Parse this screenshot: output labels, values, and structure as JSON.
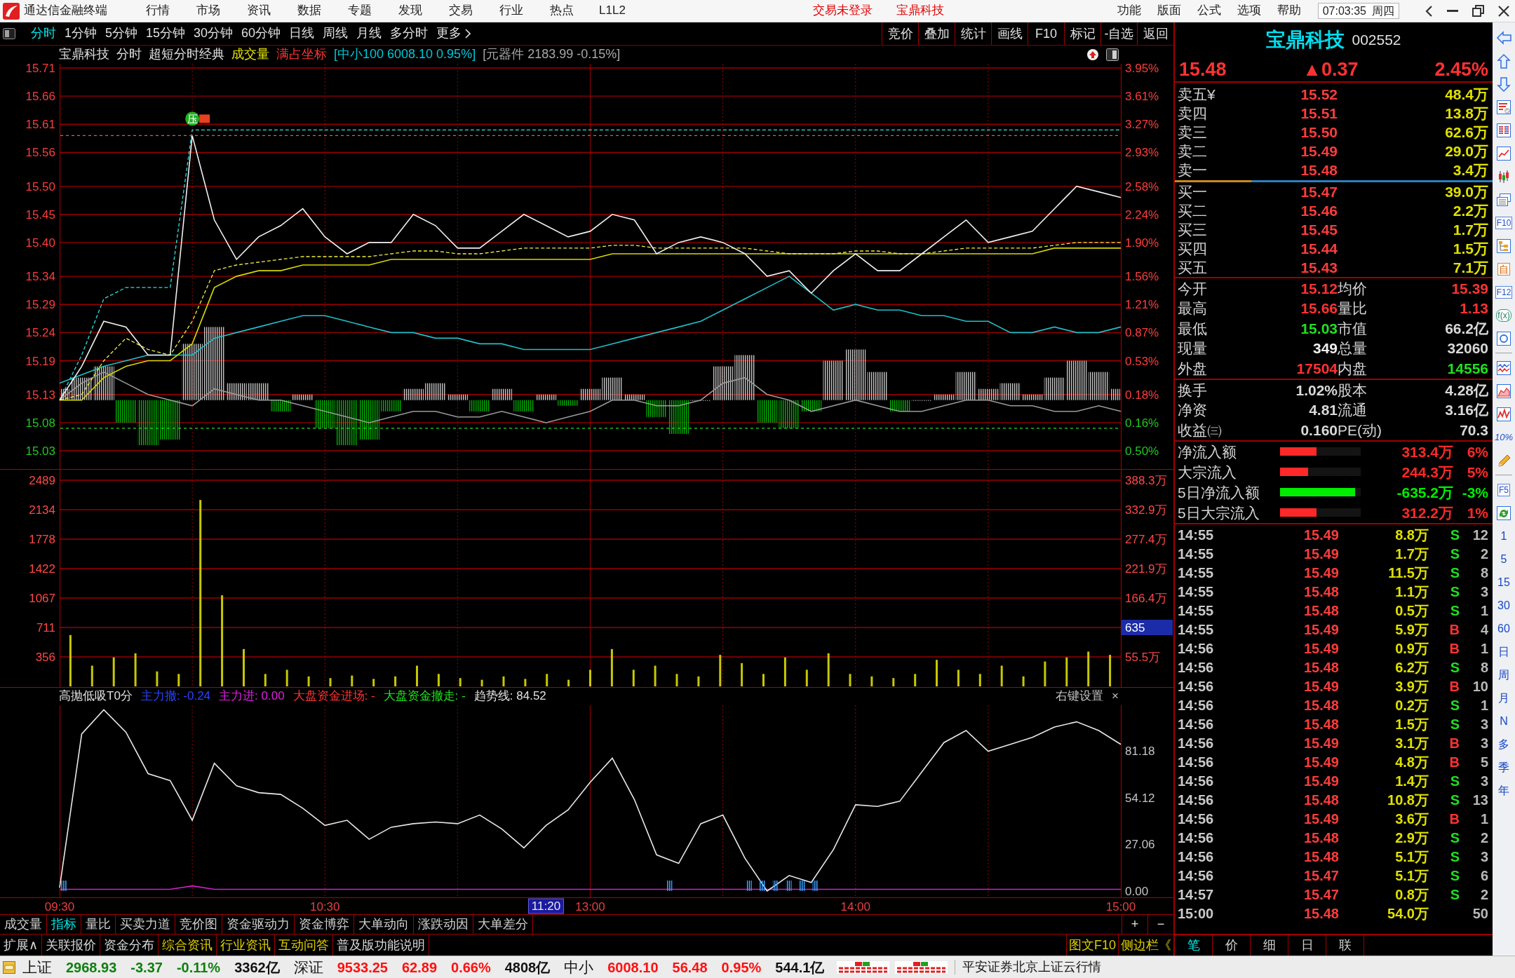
{
  "title_bar": {
    "app_title": "通达信金融终端",
    "menu": [
      "行情",
      "市场",
      "资讯",
      "数据",
      "专题",
      "发现",
      "交易",
      "行业",
      "热点",
      "L1L2"
    ],
    "notices": [
      "交易未登录",
      "宝鼎科技"
    ],
    "right_menu": [
      "功能",
      "版面",
      "公式",
      "选项",
      "帮助"
    ],
    "clock": "07:03:35",
    "weekday": "周四"
  },
  "period_bar": {
    "periods": [
      {
        "label": "分时",
        "selected": true
      },
      {
        "label": "1分钟",
        "selected": false
      },
      {
        "label": "5分钟",
        "selected": false
      },
      {
        "label": "15分钟",
        "selected": false
      },
      {
        "label": "30分钟",
        "selected": false
      },
      {
        "label": "60分钟",
        "selected": false
      },
      {
        "label": "日线",
        "selected": false
      },
      {
        "label": "周线",
        "selected": false
      },
      {
        "label": "月线",
        "selected": false
      },
      {
        "label": "多分时",
        "selected": false
      }
    ],
    "more": "更多",
    "tools": [
      "竞价",
      "叠加",
      "统计",
      "画线",
      "F10",
      "标记",
      "-自选",
      "返回"
    ]
  },
  "chart_header": [
    {
      "text": "宝鼎科技",
      "color": "#e0e0e0"
    },
    {
      "text": "分时",
      "color": "#e0e0e0"
    },
    {
      "text": "超短分时经典",
      "color": "#e0e0e0"
    },
    {
      "text": "成交量",
      "color": "#e6e600"
    },
    {
      "text": "满占坐标",
      "color": "#ff3232"
    },
    {
      "text": "[中小100 6008.10 0.95%]",
      "color": "#00c8d8"
    },
    {
      "text": "[元器件 2183.99 -0.15%]",
      "color": "#a8a8a8"
    }
  ],
  "price_chart": {
    "chart_data": {
      "type": "line",
      "ylim": [
        15.03,
        15.71
      ],
      "yticks": [
        {
          "value": 15.71,
          "label": "15.71"
        },
        {
          "value": 15.66,
          "label": "15.66"
        },
        {
          "value": 15.61,
          "label": "15.61"
        },
        {
          "value": 15.56,
          "label": "15.56"
        },
        {
          "value": 15.5,
          "label": "15.50"
        },
        {
          "value": 15.45,
          "label": "15.45"
        },
        {
          "value": 15.4,
          "label": "15.40"
        },
        {
          "value": 15.34,
          "label": "15.34"
        },
        {
          "value": 15.29,
          "label": "15.29"
        },
        {
          "value": 15.24,
          "label": "15.24"
        },
        {
          "value": 15.19,
          "label": "15.19"
        },
        {
          "value": 15.13,
          "label": "15.13"
        },
        {
          "value": 15.08,
          "label": "15.08"
        },
        {
          "value": 15.03,
          "label": "15.03"
        }
      ],
      "grid": true,
      "series": [
        {
          "color": "#9a9a9a",
          "values": [
            15.12,
            15.15,
            15.17,
            15.15,
            15.13,
            15.12,
            15.11,
            15.14,
            15.13,
            15.12,
            15.12,
            15.11,
            15.1,
            15.09,
            15.08,
            15.09,
            15.1,
            15.1,
            15.09,
            15.09,
            15.1,
            15.09,
            15.08,
            15.09,
            15.1,
            15.12,
            15.12,
            15.11,
            15.11,
            15.12,
            15.15,
            15.16,
            15.13,
            15.12,
            15.1,
            15.11,
            15.12,
            15.11,
            15.1,
            15.1,
            15.11,
            15.12,
            15.12,
            15.11,
            15.11,
            15.1,
            15.1,
            15.11,
            15.1
          ]
        },
        {
          "color": "#20c0c8",
          "values": [
            15.15,
            15.165,
            15.18,
            15.19,
            15.2,
            15.2,
            15.2,
            15.23,
            15.24,
            15.25,
            15.26,
            15.27,
            15.27,
            15.26,
            15.25,
            15.24,
            15.24,
            15.23,
            15.23,
            15.22,
            15.22,
            15.21,
            15.21,
            15.21,
            15.21,
            15.22,
            15.23,
            15.24,
            15.25,
            15.26,
            15.28,
            15.3,
            15.32,
            15.34,
            15.31,
            15.28,
            15.29,
            15.28,
            15.28,
            15.27,
            15.27,
            15.26,
            15.26,
            15.24,
            15.24,
            15.25,
            15.24,
            15.24,
            15.25
          ]
        },
        {
          "color": "#30e0e0",
          "line_style": "dashed",
          "values": [
            15.12,
            15.2,
            15.3,
            15.32,
            15.32,
            15.32,
            15.6,
            15.6,
            15.6,
            15.6,
            15.6,
            15.6,
            15.6,
            15.6,
            15.6,
            15.6,
            15.6,
            15.6,
            15.6,
            15.6,
            15.6,
            15.6,
            15.6,
            15.6,
            15.6,
            15.6,
            15.6,
            15.6,
            15.6,
            15.6,
            15.6,
            15.6,
            15.6,
            15.6,
            15.6,
            15.6,
            15.6,
            15.6,
            15.6,
            15.6,
            15.6,
            15.6,
            15.6,
            15.6,
            15.6,
            15.6,
            15.6,
            15.6,
            15.6
          ]
        },
        {
          "color": "#d8d800",
          "values": [
            15.12,
            15.12,
            15.16,
            15.18,
            15.19,
            15.19,
            15.22,
            15.32,
            15.34,
            15.35,
            15.35,
            15.36,
            15.36,
            15.36,
            15.36,
            15.37,
            15.37,
            15.37,
            15.37,
            15.37,
            15.37,
            15.37,
            15.37,
            15.37,
            15.37,
            15.38,
            15.38,
            15.38,
            15.38,
            15.38,
            15.38,
            15.38,
            15.38,
            15.38,
            15.38,
            15.38,
            15.38,
            15.38,
            15.38,
            15.38,
            15.38,
            15.38,
            15.38,
            15.38,
            15.38,
            15.39,
            15.39,
            15.39,
            15.39
          ]
        },
        {
          "color": "#f0f040",
          "line_style": "dashed",
          "values": [
            15.12,
            15.13,
            15.19,
            15.23,
            15.21,
            15.2,
            15.26,
            15.35,
            15.36,
            15.365,
            15.37,
            15.375,
            15.375,
            15.375,
            15.375,
            15.38,
            15.385,
            15.385,
            15.38,
            15.38,
            15.385,
            15.39,
            15.39,
            15.39,
            15.39,
            15.395,
            15.395,
            15.39,
            15.39,
            15.39,
            15.39,
            15.39,
            15.385,
            15.38,
            15.38,
            15.38,
            15.385,
            15.385,
            15.38,
            15.38,
            15.385,
            15.39,
            15.39,
            15.39,
            15.39,
            15.395,
            15.4,
            15.4,
            15.4
          ]
        },
        {
          "color": "#f0f0f0",
          "values": [
            15.12,
            15.18,
            15.26,
            15.25,
            15.2,
            15.2,
            15.59,
            15.44,
            15.37,
            15.41,
            15.43,
            15.46,
            15.41,
            15.38,
            15.4,
            15.4,
            15.45,
            15.43,
            15.39,
            15.39,
            15.42,
            15.45,
            15.43,
            15.41,
            15.42,
            15.45,
            15.44,
            15.38,
            15.4,
            15.41,
            15.4,
            15.38,
            15.34,
            15.35,
            15.31,
            15.35,
            15.38,
            15.35,
            15.35,
            15.38,
            15.41,
            15.44,
            15.4,
            15.41,
            15.42,
            15.46,
            15.5,
            15.49,
            15.48
          ]
        }
      ],
      "ref_lines": [
        {
          "axis": "y",
          "value": 15.59,
          "color": "#d06060",
          "line_style": "dashed"
        },
        {
          "axis": "y",
          "value": 15.07,
          "color": "#20e020",
          "line_style": "dashed"
        }
      ],
      "annotations": [
        "压"
      ]
    },
    "right_ticks": [
      "3.95%",
      "3.61%",
      "3.27%",
      "2.93%",
      "2.58%",
      "2.24%",
      "1.90%",
      "1.56%",
      "1.21%",
      "0.87%",
      "0.53%",
      "0.18%",
      "0.16%",
      "0.50%"
    ]
  },
  "volume_chart": {
    "chart_data": {
      "type": "bar",
      "ylim": [
        0,
        2616
      ],
      "yticks": [
        {
          "value": 2489,
          "label": "2489"
        },
        {
          "value": 2134,
          "label": "2134"
        },
        {
          "value": 1778,
          "label": "1778"
        },
        {
          "value": 1422,
          "label": "1422"
        },
        {
          "value": 1067,
          "label": "1067"
        },
        {
          "value": 711,
          "label": "711"
        },
        {
          "value": 356,
          "label": "356"
        }
      ],
      "grid": true,
      "series": [
        {
          "color": "#c8c800",
          "values": [
            620,
            250,
            350,
            400,
            180,
            150,
            2250,
            1100,
            450,
            150,
            200,
            120,
            100,
            130,
            90,
            120,
            250,
            150,
            100,
            80,
            120,
            90,
            150,
            80,
            200,
            450,
            200,
            250,
            150,
            120,
            380,
            280,
            150,
            350,
            200,
            400,
            150,
            120,
            100,
            150,
            320,
            200,
            150,
            250,
            120,
            300,
            350,
            420,
            380
          ]
        }
      ]
    },
    "right_axis": [
      {
        "text": "388.3万",
        "kind": "tick"
      },
      {
        "text": "332.9万",
        "kind": "tick"
      },
      {
        "text": "277.4万",
        "kind": "tick"
      },
      {
        "text": "221.9万",
        "kind": "tick"
      },
      {
        "text": "166.4万",
        "kind": "tick"
      },
      {
        "text": "635",
        "kind": "readout"
      },
      {
        "text": "55.5万",
        "kind": "tick"
      }
    ]
  },
  "indicator_header": {
    "items": [
      {
        "text": "高抛低吸T0分",
        "color": "#e0e0e0"
      },
      {
        "text": "主力撤: -0.24",
        "color": "#2a44ff"
      },
      {
        "text": "主力进: 0.00",
        "color": "#e020e0"
      },
      {
        "text": "大盘资金进场: -",
        "color": "#ff3030"
      },
      {
        "text": "大盘资金撤走: -",
        "color": "#20e020"
      },
      {
        "text": "趋势线: 84.52",
        "color": "#e0e0e0"
      }
    ],
    "settings": "右键设置",
    "close": "×"
  },
  "indicator_chart": {
    "chart_data": {
      "type": "line",
      "categories": [
        "09:30",
        null,
        null,
        null,
        null,
        null,
        null,
        null,
        null,
        null,
        null,
        null,
        "10:30",
        null,
        null,
        null,
        null,
        null,
        null,
        null,
        null,
        null,
        null,
        null,
        "13:00",
        null,
        null,
        null,
        null,
        null,
        null,
        null,
        null,
        null,
        null,
        null,
        "14:00",
        null,
        null,
        null,
        null,
        null,
        null,
        null,
        null,
        null,
        null,
        null,
        "15:00"
      ],
      "ylim": [
        0,
        107.6
      ],
      "yticks": [
        {
          "value": 81.18,
          "label": "81.18"
        },
        {
          "value": 54.12,
          "label": "54.12"
        },
        {
          "value": 27.06,
          "label": "27.06"
        },
        {
          "value": 0,
          "label": "0.00"
        }
      ],
      "grid": true,
      "series": [
        {
          "color": "#d020d0",
          "values": [
            1,
            1,
            1,
            1,
            1,
            1,
            3,
            1,
            1,
            1,
            1,
            1,
            1,
            1,
            1,
            1,
            1,
            1,
            1,
            1,
            1,
            1,
            1,
            1,
            1,
            1,
            1,
            1,
            1,
            1,
            1,
            1,
            1,
            1,
            1,
            1,
            1,
            1,
            1,
            1,
            1,
            1,
            1,
            1,
            1,
            1,
            1,
            1,
            1
          ]
        },
        {
          "color": "#e8e8e8",
          "values": [
            2,
            91,
            105,
            92,
            68,
            64,
            41,
            74,
            61,
            57,
            56,
            48,
            38,
            41,
            30,
            37,
            39,
            40,
            39,
            44,
            36,
            25,
            38,
            47,
            63,
            77,
            53,
            21,
            16,
            39,
            44,
            19,
            0,
            9,
            5,
            24,
            50,
            49,
            52,
            69,
            86,
            93,
            81,
            85,
            89,
            95,
            98,
            93,
            85
          ]
        }
      ],
      "annotations": [
        "11:20"
      ]
    }
  },
  "indicator_tabs": [
    {
      "label": "成交量",
      "selected": false
    },
    {
      "label": "指标",
      "selected": true
    },
    {
      "label": "量比",
      "selected": false
    },
    {
      "label": "买卖力道",
      "selected": false
    },
    {
      "label": "竞价图",
      "selected": false
    },
    {
      "label": "资金驱动力",
      "selected": false
    },
    {
      "label": "资金博弈",
      "selected": false
    },
    {
      "label": "大单动向",
      "selected": false
    },
    {
      "label": "涨跌动因",
      "selected": false
    },
    {
      "label": "大单差分",
      "selected": false
    }
  ],
  "zoom_buttons": [
    "+",
    "−"
  ],
  "extension_tabs": [
    {
      "label": "扩展∧",
      "color": "#d8d8d8"
    },
    {
      "label": "关联报价",
      "color": "#d8d8d8"
    },
    {
      "label": "资金分布",
      "color": "#d8d8d8"
    },
    {
      "label": "综合资讯",
      "color": "#e0d000"
    },
    {
      "label": "行业资讯",
      "color": "#e0d000"
    },
    {
      "label": "互动问答",
      "color": "#e0d000"
    },
    {
      "label": "普及版功能说明",
      "color": "#d8d8d8"
    }
  ],
  "side_links": [
    "图文F10",
    "侧边栏《"
  ],
  "quote": {
    "name": "宝鼎科技",
    "code": "002552",
    "price": "15.48",
    "change": "▲0.37",
    "change_pct": "2.45%",
    "asks": [
      {
        "label": "卖五¥",
        "price": "15.52",
        "volume": "48.4万"
      },
      {
        "label": "卖四",
        "price": "15.51",
        "volume": "13.8万"
      },
      {
        "label": "卖三",
        "price": "15.50",
        "volume": "62.6万"
      },
      {
        "label": "卖二",
        "price": "15.49",
        "volume": "29.0万"
      },
      {
        "label": "卖一",
        "price": "15.48",
        "volume": "3.4万"
      }
    ],
    "bid_ratio": {
      "level": 0.24
    },
    "bids": [
      {
        "label": "买一",
        "price": "15.47",
        "volume": "39.0万"
      },
      {
        "label": "买二",
        "price": "15.46",
        "volume": "2.2万"
      },
      {
        "label": "买三",
        "price": "15.45",
        "volume": "1.7万"
      },
      {
        "label": "买四",
        "price": "15.44",
        "volume": "1.5万"
      },
      {
        "label": "买五",
        "price": "15.43",
        "volume": "7.1万"
      }
    ],
    "stats": [
      {
        "label": "今开",
        "value": "15.12",
        "color": "#ff3232"
      },
      {
        "label": "均价",
        "value": "15.39",
        "color": "#ff3232"
      },
      {
        "label": "最高",
        "value": "15.66",
        "color": "#ff3232"
      },
      {
        "label": "量比",
        "value": "1.13",
        "color": "#ff3232"
      },
      {
        "label": "最低",
        "value": "15.03",
        "color": "#20e020"
      },
      {
        "label": "市值",
        "value": "66.2亿",
        "color": "#d8d8d8"
      },
      {
        "label": "现量",
        "value": "349",
        "color": "#f0f0f0"
      },
      {
        "label": "总量",
        "value": "32060",
        "color": "#d8d8d8"
      },
      {
        "label": "外盘",
        "value": "17504",
        "color": "#ff3232"
      },
      {
        "label": "内盘",
        "value": "14556",
        "color": "#20e020"
      }
    ],
    "fundamentals": [
      {
        "label": "换手",
        "value": "1.02%"
      },
      {
        "label": "股本",
        "value": "4.28亿"
      },
      {
        "label": "净资",
        "value": "4.81"
      },
      {
        "label": "流通",
        "value": "3.16亿"
      },
      {
        "label": "收益㈢",
        "value": "0.160"
      },
      {
        "label": "PE(动)",
        "value": "70.3"
      }
    ],
    "fund_flows": [
      {
        "label": "净流入额",
        "level": 0.45,
        "value": "313.4万",
        "pct": "6%",
        "color": "#ff2828"
      },
      {
        "label": "大宗流入",
        "level": 0.35,
        "value": "244.3万",
        "pct": "5%",
        "color": "#ff2828"
      },
      {
        "label": "5日净流入额",
        "level": 0.93,
        "value": "-635.2万",
        "pct": "-3%",
        "color": "#00ee00"
      },
      {
        "label": "5日大宗流入",
        "level": 0.45,
        "value": "312.2万",
        "pct": "1%",
        "color": "#ff2828"
      }
    ],
    "trades": [
      {
        "time": "14:55",
        "price": "15.49",
        "volume": "8.8万",
        "side": "S",
        "kind": "sell",
        "count": "12"
      },
      {
        "time": "14:55",
        "price": "15.49",
        "volume": "1.7万",
        "side": "S",
        "kind": "sell",
        "count": "2"
      },
      {
        "time": "14:55",
        "price": "15.49",
        "volume": "11.5万",
        "side": "S",
        "kind": "sell",
        "count": "8"
      },
      {
        "time": "14:55",
        "price": "15.48",
        "volume": "1.1万",
        "side": "S",
        "kind": "sell",
        "count": "3"
      },
      {
        "time": "14:55",
        "price": "15.48",
        "volume": "0.5万",
        "side": "S",
        "kind": "sell",
        "count": "1"
      },
      {
        "time": "14:55",
        "price": "15.49",
        "volume": "5.9万",
        "side": "B",
        "kind": "buy",
        "count": "4"
      },
      {
        "time": "14:56",
        "price": "15.49",
        "volume": "0.9万",
        "side": "B",
        "kind": "buy",
        "count": "1"
      },
      {
        "time": "14:56",
        "price": "15.48",
        "volume": "6.2万",
        "side": "S",
        "kind": "sell",
        "count": "8"
      },
      {
        "time": "14:56",
        "price": "15.49",
        "volume": "3.9万",
        "side": "B",
        "kind": "buy",
        "count": "10"
      },
      {
        "time": "14:56",
        "price": "15.48",
        "volume": "0.2万",
        "side": "S",
        "kind": "sell",
        "count": "1"
      },
      {
        "time": "14:56",
        "price": "15.48",
        "volume": "1.5万",
        "side": "S",
        "kind": "sell",
        "count": "3"
      },
      {
        "time": "14:56",
        "price": "15.49",
        "volume": "3.1万",
        "side": "B",
        "kind": "buy",
        "count": "3"
      },
      {
        "time": "14:56",
        "price": "15.49",
        "volume": "4.8万",
        "side": "B",
        "kind": "buy",
        "count": "5"
      },
      {
        "time": "14:56",
        "price": "15.49",
        "volume": "1.4万",
        "side": "S",
        "kind": "sell",
        "count": "3"
      },
      {
        "time": "14:56",
        "price": "15.48",
        "volume": "10.8万",
        "side": "S",
        "kind": "sell",
        "count": "13"
      },
      {
        "time": "14:56",
        "price": "15.49",
        "volume": "3.6万",
        "side": "B",
        "kind": "buy",
        "count": "1"
      },
      {
        "time": "14:56",
        "price": "15.48",
        "volume": "2.9万",
        "side": "S",
        "kind": "sell",
        "count": "2"
      },
      {
        "time": "14:56",
        "price": "15.48",
        "volume": "5.1万",
        "side": "S",
        "kind": "sell",
        "count": "3"
      },
      {
        "time": "14:56",
        "price": "15.47",
        "volume": "5.1万",
        "side": "S",
        "kind": "sell",
        "count": "6"
      },
      {
        "time": "14:57",
        "price": "15.47",
        "volume": "0.8万",
        "side": "S",
        "kind": "sell",
        "count": "2"
      },
      {
        "time": "15:00",
        "price": "15.48",
        "volume": "54.0万",
        "kind": "auction",
        "count": "50"
      }
    ],
    "tabs": [
      {
        "label": "笔",
        "selected": true
      },
      {
        "label": "价",
        "selected": false
      },
      {
        "label": "细",
        "selected": false
      },
      {
        "label": "日",
        "selected": false
      },
      {
        "label": "联",
        "selected": false
      }
    ]
  },
  "side_toolbar": {
    "tiles": [
      "F10",
      "自",
      "F12",
      "f(x)",
      "10%",
      "F5"
    ],
    "periods": [
      "1",
      "5",
      "15",
      "30",
      "60",
      "日",
      "周",
      "月",
      "N",
      "多",
      "季",
      "年"
    ]
  },
  "status_bar": {
    "indices": [
      {
        "name": "上证",
        "value": "2968.93",
        "change": "-3.37",
        "pct": "-0.11%",
        "amount": "3362亿",
        "color": "#108010"
      },
      {
        "name": "深证",
        "value": "9533.25",
        "change": "62.89",
        "pct": "0.66%",
        "amount": "4808亿",
        "color": "#ff1010"
      },
      {
        "name": "中小",
        "value": "6008.10",
        "change": "56.48",
        "pct": "0.95%",
        "amount": "544.1亿",
        "color": "#ff1010"
      }
    ],
    "feed": "平安证券北京上证云行情"
  }
}
